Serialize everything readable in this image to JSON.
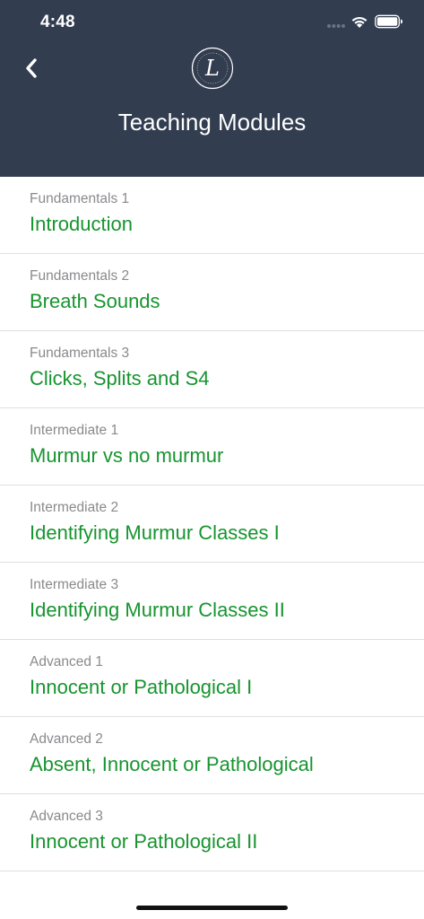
{
  "status_bar": {
    "time": "4:48"
  },
  "header": {
    "title": "Teaching Modules",
    "back_icon": "chevron-left-icon",
    "logo_letter": "L",
    "background_color": "#323d50"
  },
  "modules": [
    {
      "category": "Fundamentals 1",
      "title": "Introduction"
    },
    {
      "category": "Fundamentals 2",
      "title": "Breath Sounds"
    },
    {
      "category": "Fundamentals 3",
      "title": "Clicks, Splits and S4"
    },
    {
      "category": "Intermediate 1",
      "title": "Murmur vs no murmur"
    },
    {
      "category": "Intermediate 2",
      "title": "Identifying Murmur Classes I"
    },
    {
      "category": "Intermediate 3",
      "title": "Identifying Murmur Classes II"
    },
    {
      "category": "Advanced 1",
      "title": "Innocent or Pathological I"
    },
    {
      "category": "Advanced 2",
      "title": "Absent, Innocent or Pathological"
    },
    {
      "category": "Advanced 3",
      "title": "Innocent or Pathological II"
    }
  ],
  "colors": {
    "accent_green": "#17942f",
    "subtitle_gray": "#8a8a8e",
    "divider": "#dfdfe2"
  }
}
